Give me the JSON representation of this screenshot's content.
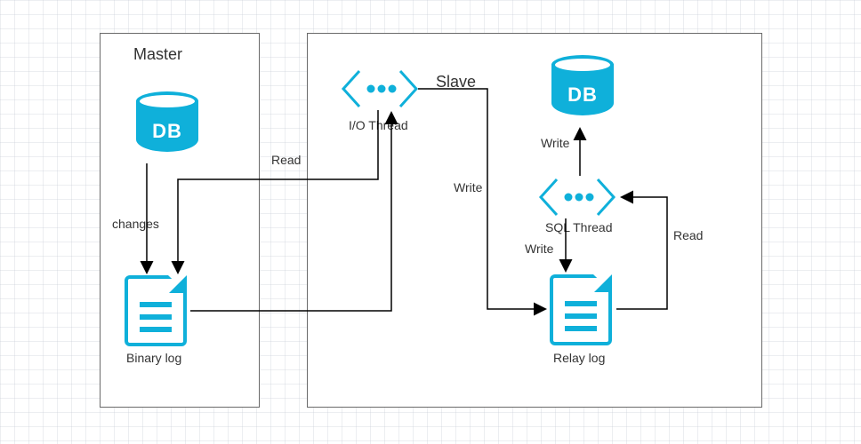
{
  "master": {
    "title": "Master",
    "db_label": "DB",
    "changes_label": "changes",
    "binary_log_label": "Binary log"
  },
  "slave": {
    "title": "Slave",
    "db_label": "DB",
    "io_thread_label": "I/O Thread",
    "sql_thread_label": "SQL Thread",
    "relay_log_label": "Relay log",
    "read_label_left": "Read",
    "read_label_right": "Read",
    "write_label_top": "Write",
    "write_label_center": "Write",
    "write_label_sql": "Write"
  },
  "colors": {
    "accent": "#0fb0da",
    "border": "#6a6a6a",
    "text": "#333333"
  }
}
